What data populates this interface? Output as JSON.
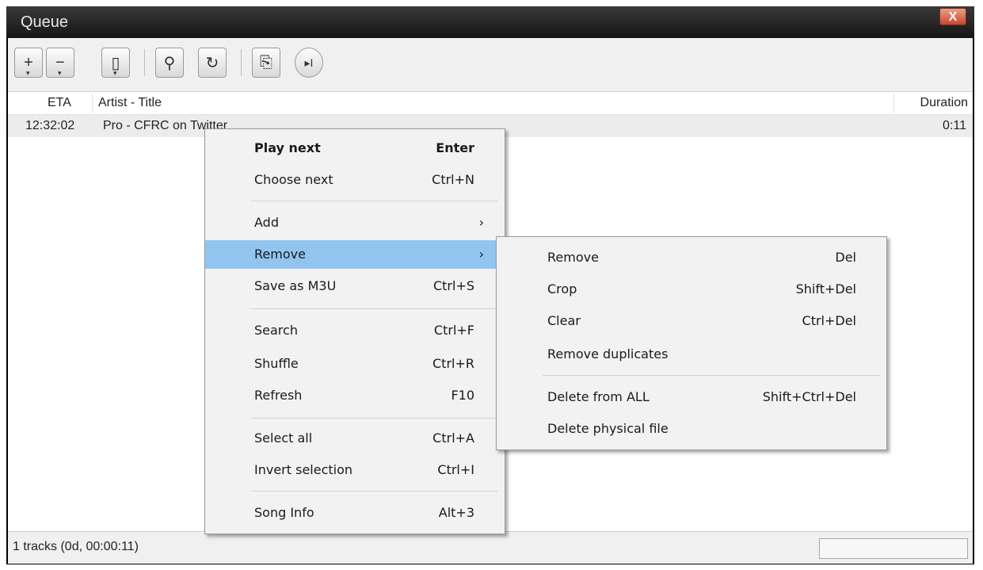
{
  "window": {
    "title": "Queue",
    "close_label": "X"
  },
  "toolbar": {
    "buttons": [
      {
        "icon": "plus-icon",
        "glyph": "+"
      },
      {
        "icon": "minus-icon",
        "glyph": "−"
      },
      {
        "icon": "save-icon",
        "glyph": "▯"
      },
      {
        "icon": "search-icon",
        "glyph": "⚲"
      },
      {
        "icon": "refresh-icon",
        "glyph": "↻"
      },
      {
        "icon": "export-icon",
        "glyph": "⎘"
      },
      {
        "icon": "play-next-icon",
        "glyph": "▸I"
      }
    ]
  },
  "list": {
    "columns": {
      "eta": "ETA",
      "title": "Artist - Title",
      "duration": "Duration"
    },
    "rows": [
      {
        "eta": "12:32:02",
        "title": "Pro - CFRC on Twitter",
        "duration": "0:11"
      }
    ]
  },
  "context_menu": {
    "items": [
      {
        "label": "Play next",
        "shortcut": "Enter"
      },
      {
        "label": "Choose next",
        "shortcut": "Ctrl+N"
      },
      {
        "label": "Add",
        "shortcut": "›"
      },
      {
        "label": "Remove",
        "shortcut": "›"
      },
      {
        "label": "Save as M3U",
        "shortcut": "Ctrl+S"
      },
      {
        "label": "Search",
        "shortcut": "Ctrl+F"
      },
      {
        "label": "Shuffle",
        "shortcut": "Ctrl+R"
      },
      {
        "label": "Refresh",
        "shortcut": "F10"
      },
      {
        "label": "Select all",
        "shortcut": "Ctrl+A"
      },
      {
        "label": "Invert selection",
        "shortcut": "Ctrl+I"
      },
      {
        "label": "Song Info",
        "shortcut": "Alt+3"
      }
    ]
  },
  "submenu": {
    "items": [
      {
        "label": "Remove",
        "shortcut": "Del"
      },
      {
        "label": "Crop",
        "shortcut": "Shift+Del"
      },
      {
        "label": "Clear",
        "shortcut": "Ctrl+Del"
      },
      {
        "label": "Remove duplicates",
        "shortcut": ""
      },
      {
        "label": "Delete from ALL",
        "shortcut": "Shift+Ctrl+Del"
      },
      {
        "label": "Delete physical file",
        "shortcut": ""
      }
    ]
  },
  "status": {
    "text": "1 tracks (0d, 00:00:11)"
  },
  "colors": {
    "highlight": "#92c4f0",
    "titlebar": "#1f1f1f",
    "close": "#c8452b"
  }
}
